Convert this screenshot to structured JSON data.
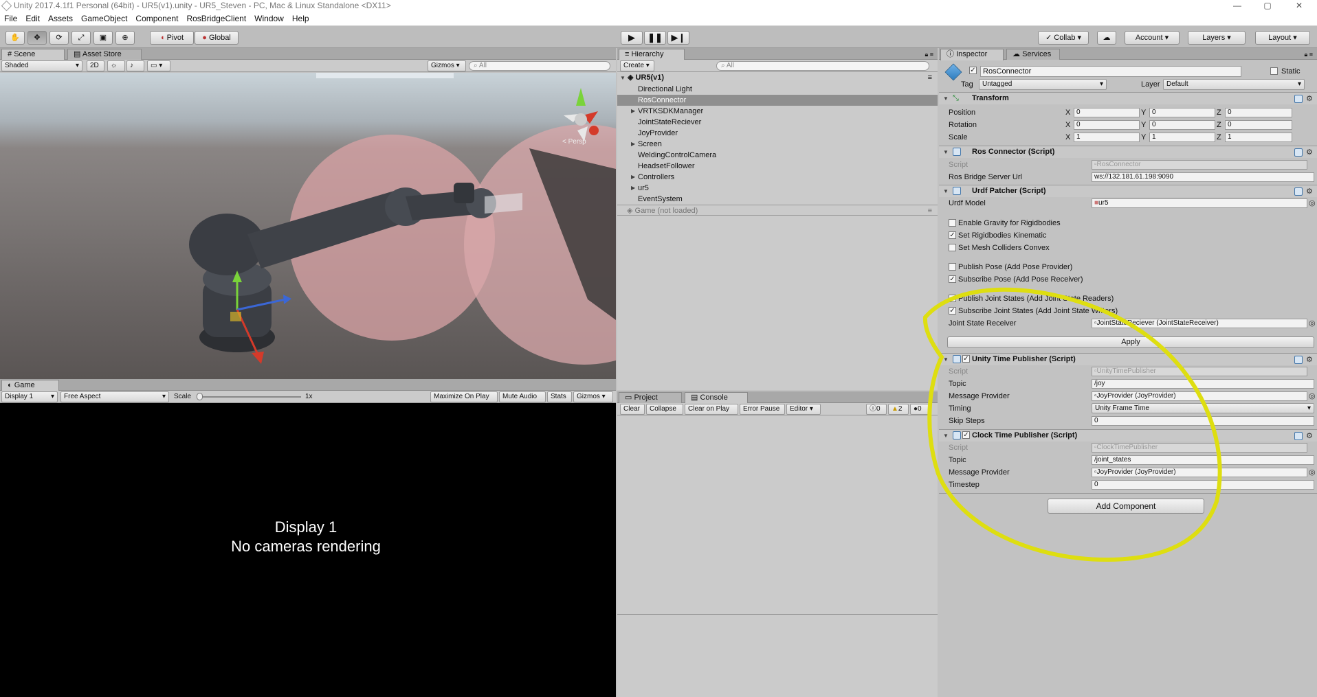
{
  "window": {
    "title": "Unity 2017.4.1f1 Personal (64bit) - UR5(v1).unity - UR5_Steven - PC, Mac & Linux Standalone <DX11>",
    "minimize": "—",
    "maximize": "▢",
    "close": "✕"
  },
  "menu": [
    "File",
    "Edit",
    "Assets",
    "GameObject",
    "Component",
    "RosBridgeClient",
    "Window",
    "Help"
  ],
  "toolbar": {
    "pivot": "Pivot",
    "global": "Global",
    "collab": "Collab ▾",
    "account": "Account",
    "layers": "Layers",
    "layout": "Layout"
  },
  "scene": {
    "tab": "Scene",
    "asset_store_tab": "Asset Store",
    "shading": "Shaded",
    "mode2d": "2D",
    "gizmos": "Gizmos",
    "search_placeholder": "All",
    "persp": "< Persp"
  },
  "game": {
    "tab": "Game",
    "display": "Display 1",
    "aspect": "Free Aspect",
    "scale_label": "Scale",
    "scale_value": "1x",
    "maximize": "Maximize On Play",
    "mute": "Mute Audio",
    "stats": "Stats",
    "gizmos": "Gizmos",
    "message_line1": "Display 1",
    "message_line2": "No cameras rendering"
  },
  "hierarchy": {
    "tab": "Hierarchy",
    "create": "Create",
    "search_placeholder": "All",
    "scene_name": "UR5(v1)",
    "items": [
      {
        "label": "Directional Light",
        "expandable": false
      },
      {
        "label": "RosConnector",
        "expandable": false,
        "selected": true
      },
      {
        "label": "VRTKSDKManager",
        "expandable": true
      },
      {
        "label": "JointStateReciever",
        "expandable": false
      },
      {
        "label": "JoyProvider",
        "expandable": false
      },
      {
        "label": "Screen",
        "expandable": true
      },
      {
        "label": "WeldingControlCamera",
        "expandable": false
      },
      {
        "label": "HeadsetFollower",
        "expandable": false
      },
      {
        "label": "Controllers",
        "expandable": true
      },
      {
        "label": "ur5",
        "expandable": true
      },
      {
        "label": "EventSystem",
        "expandable": false
      }
    ],
    "game_scene": "Game (not loaded)"
  },
  "console": {
    "project_tab": "Project",
    "console_tab": "Console",
    "clear": "Clear",
    "collapse": "Collapse",
    "clear_on_play": "Clear on Play",
    "error_pause": "Error Pause",
    "editor": "Editor",
    "info_count": "0",
    "warn_count": "2",
    "error_count": "0"
  },
  "inspector": {
    "tab": "Inspector",
    "services_tab": "Services",
    "object_name": "RosConnector",
    "static": "Static",
    "tag_label": "Tag",
    "tag_value": "Untagged",
    "layer_label": "Layer",
    "layer_value": "Default",
    "transform": {
      "title": "Transform",
      "position_label": "Position",
      "rotation_label": "Rotation",
      "scale_label": "Scale",
      "position": [
        "0",
        "0",
        "0"
      ],
      "rotation": [
        "0",
        "0",
        "0"
      ],
      "scale": [
        "1",
        "1",
        "1"
      ],
      "x": "X",
      "y": "Y",
      "z": "Z"
    },
    "ros_connector": {
      "title": "Ros Connector (Script)",
      "script_label": "Script",
      "script_value": "RosConnector",
      "url_label": "Ros Bridge Server Url",
      "url_value": "ws://132.181.61.198:9090"
    },
    "urdf_patcher": {
      "title": "Urdf Patcher (Script)",
      "model_label": "Urdf Model",
      "model_value": "ur5",
      "enable_gravity": "Enable Gravity for Rigidbodies",
      "set_kinematic": "Set Rigidbodies Kinematic",
      "set_convex": "Set Mesh Colliders Convex",
      "publish_pose": "Publish Pose (Add Pose Provider)",
      "subscribe_pose": "Subscribe Pose (Add Pose Receiver)",
      "publish_joint": "Publish Joint States (Add Joint State Readers)",
      "subscribe_joint": "Subscribe Joint States (Add Joint State Writers)",
      "receiver_label": "Joint State Receiver",
      "receiver_value": "JointStateReciever (JointStateReceiver)",
      "apply": "Apply"
    },
    "unity_time": {
      "title": "Unity Time Publisher (Script)",
      "script_label": "Script",
      "script_value": "UnityTimePublisher",
      "topic_label": "Topic",
      "topic_value": "/joy",
      "provider_label": "Message Provider",
      "provider_value": "JoyProvider (JoyProvider)",
      "timing_label": "Timing",
      "timing_value": "Unity Frame Time",
      "skip_label": "Skip Steps",
      "skip_value": "0"
    },
    "clock_time": {
      "title": "Clock Time Publisher (Script)",
      "script_label": "Script",
      "script_value": "ClockTimePublisher",
      "topic_label": "Topic",
      "topic_value": "/joint_states",
      "provider_label": "Message Provider",
      "provider_value": "JoyProvider (JoyProvider)",
      "timestep_label": "Timestep",
      "timestep_value": "0"
    },
    "add_component": "Add Component"
  },
  "colors": {
    "annotation": "#dede10",
    "scene_sky": "#b8c4cc",
    "scene_ground": "#6f6a69"
  }
}
